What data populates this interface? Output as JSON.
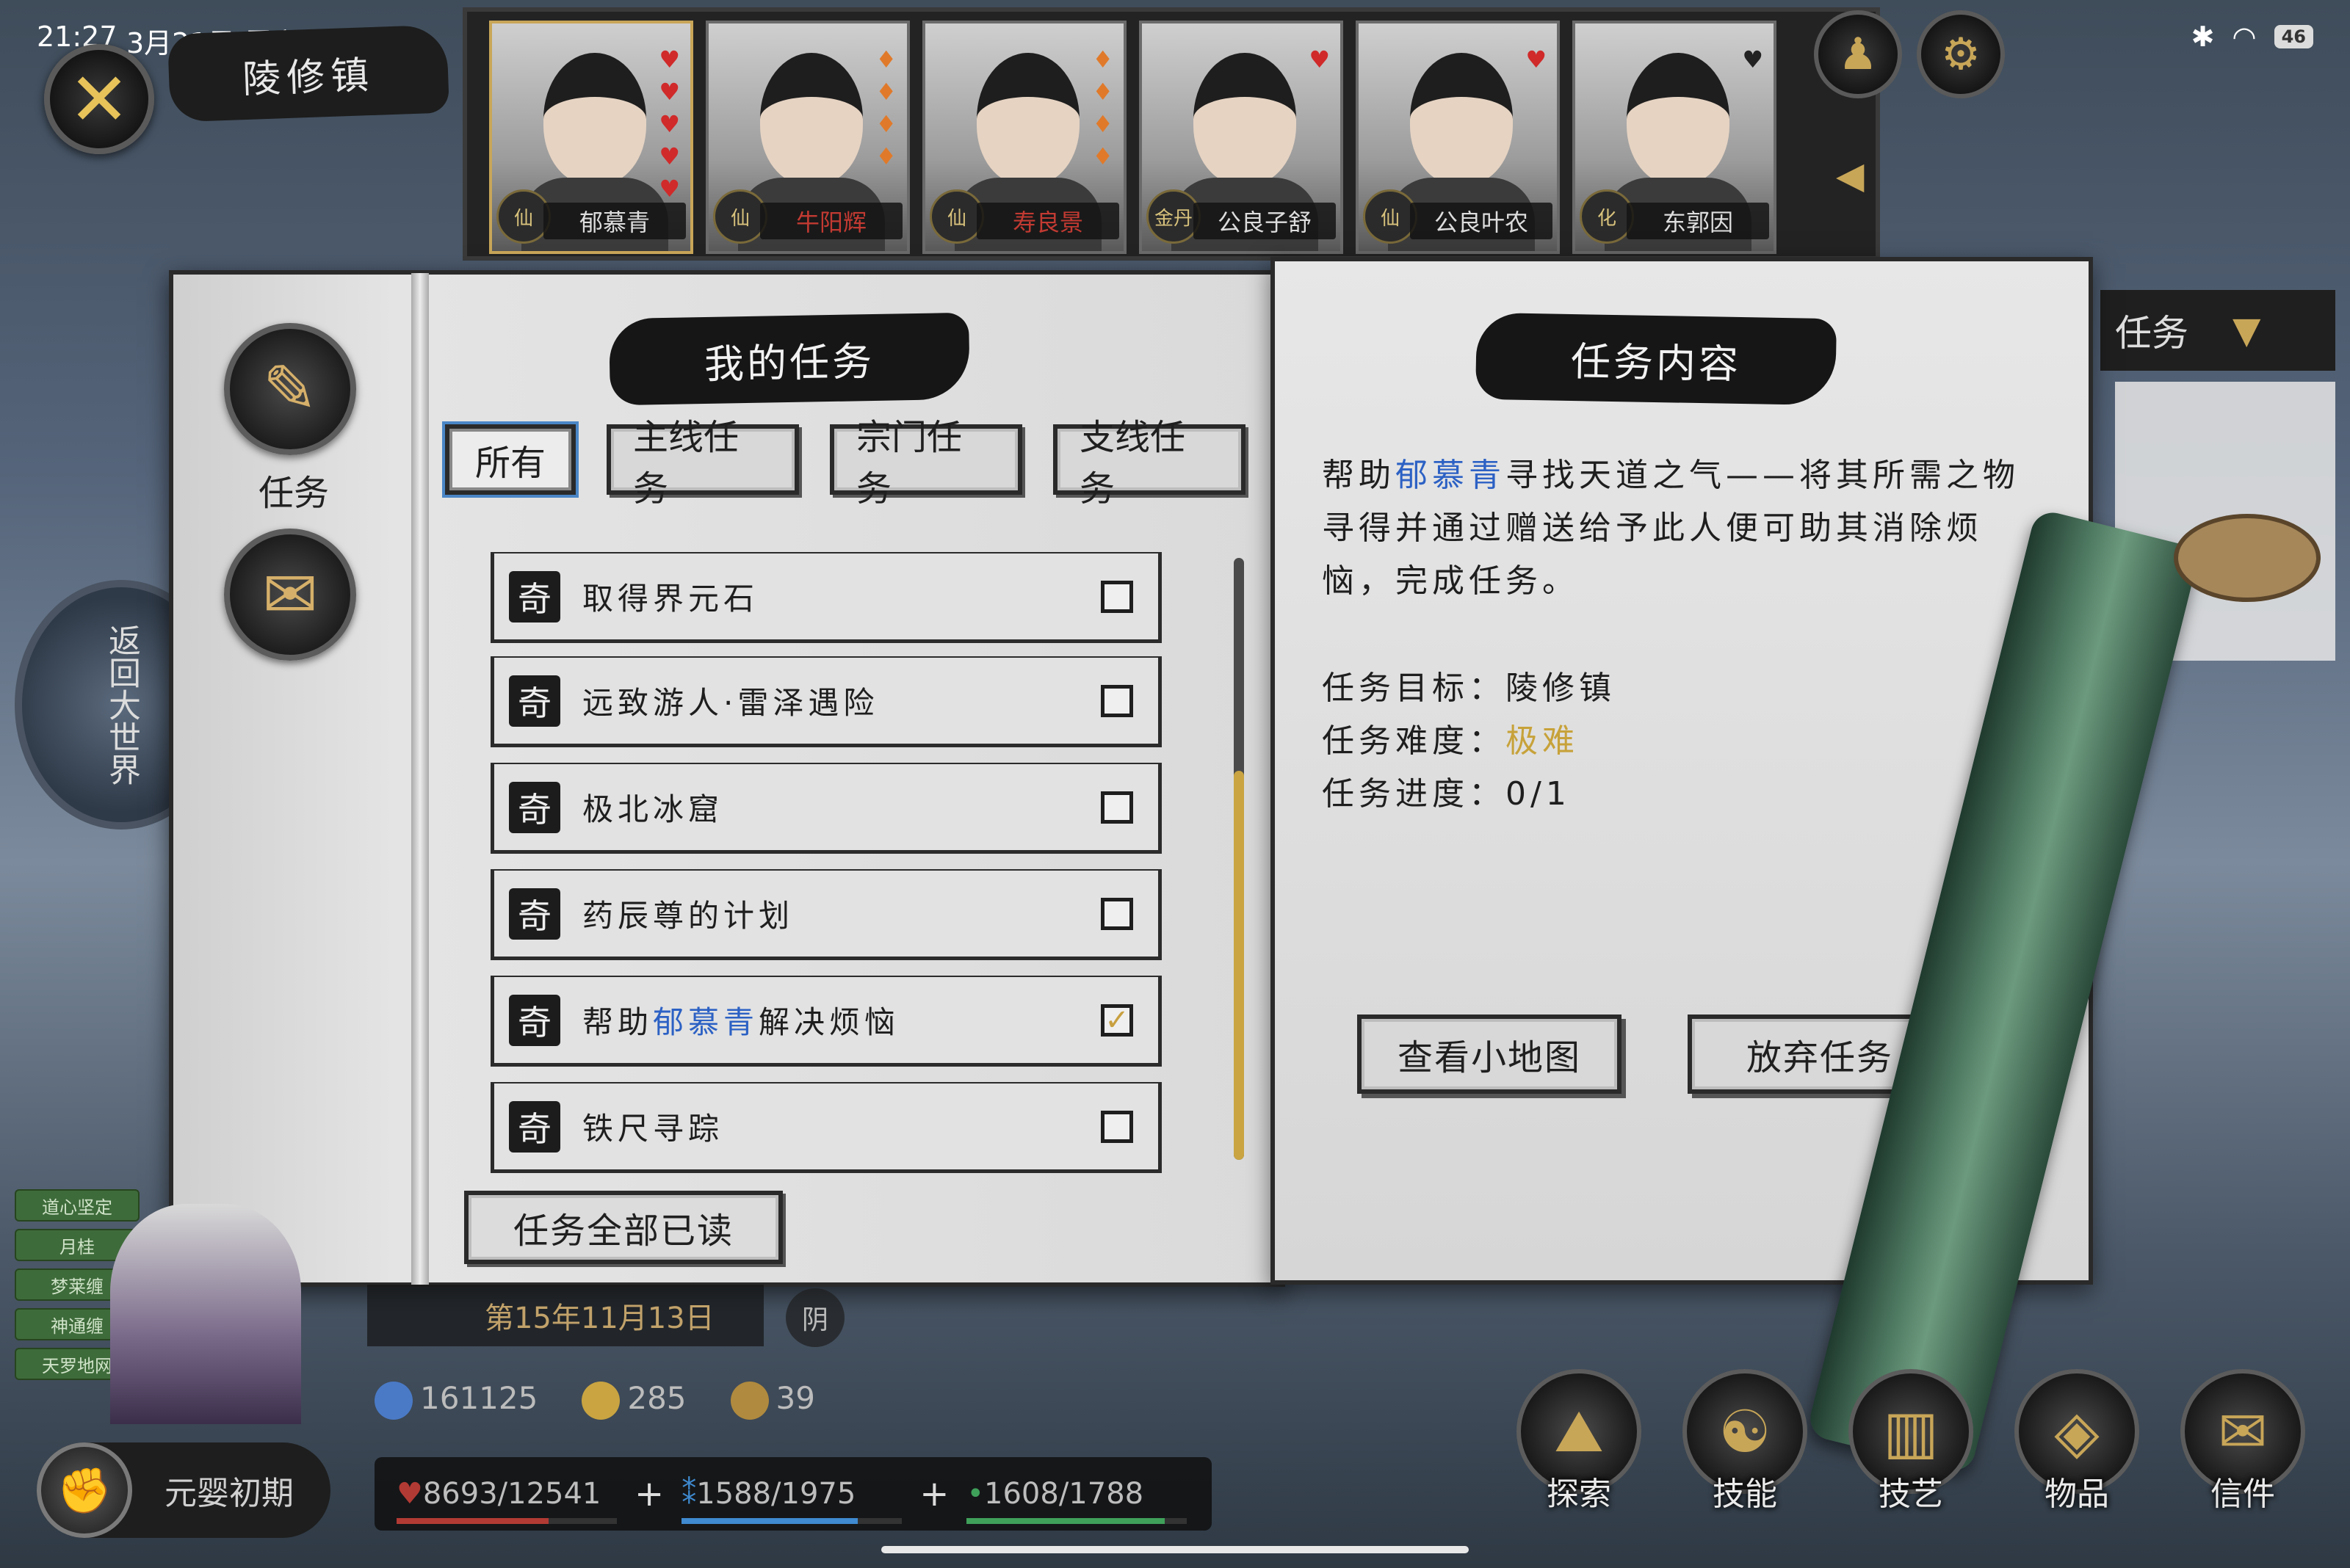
{
  "status_bar": {
    "time": "21:27",
    "date": "3月21日 周六",
    "battery": "46"
  },
  "location": "陵修镇",
  "characters": [
    {
      "name": "郁慕青",
      "seal": "仙"
    },
    {
      "name": "牛阳辉",
      "seal": "仙"
    },
    {
      "name": "寿良景",
      "seal": "仙"
    },
    {
      "name": "公良子舒",
      "seal": "金丹"
    },
    {
      "name": "公良叶农",
      "seal": "仙"
    },
    {
      "name": "东郭因",
      "seal": "化"
    }
  ],
  "right_tab": {
    "label": "任务"
  },
  "world_map": {
    "label": "返回大世界"
  },
  "book": {
    "side_icon_quest_label": "任务",
    "my_quests_title": "我的任务",
    "quest_content_title": "任务内容",
    "filter_tabs": [
      "所有",
      "主线任务",
      "宗门任务",
      "支线任务"
    ],
    "quests": [
      {
        "tag": "奇",
        "name": "取得界元石",
        "checked": false
      },
      {
        "tag": "奇",
        "name": "远致游人·雷泽遇险",
        "checked": false
      },
      {
        "tag": "奇",
        "name": "极北冰窟",
        "checked": false
      },
      {
        "tag": "奇",
        "name": "药辰尊的计划",
        "checked": false
      },
      {
        "tag": "奇",
        "name_pre": "帮助",
        "name_hl": "郁慕青",
        "name_post": "解决烦恼",
        "checked": true
      },
      {
        "tag": "奇",
        "name": "铁尺寻踪",
        "checked": false
      }
    ],
    "mark_all_read": "任务全部已读",
    "detail": {
      "desc_pre": "帮助",
      "desc_hl": "郁慕青",
      "desc_post": "寻找天道之气——将其所需之物寻得并通过赠送给予此人便可助其消除烦恼，完成任务。",
      "target_label": "任务目标：",
      "target_value": "陵修镇",
      "difficulty_label": "任务难度：",
      "difficulty_value": "极难",
      "progress_label": "任务进度：",
      "progress_value": "0/1"
    },
    "view_map_btn": "查看小地图",
    "abandon_btn": "放弃任务"
  },
  "hud": {
    "buffs": [
      "道心坚定",
      "月桂",
      "梦莱缠",
      "神通缠",
      "天罗地网"
    ],
    "date": "第15年11月13日",
    "date_badge": "阴",
    "spirit_stones": "161125",
    "coins": "285",
    "tokens": "39",
    "realm": "元婴初期",
    "hp": "8693/12541",
    "mp": "1588/1975",
    "stamina": "1608/1788",
    "menu": [
      "探索",
      "技能",
      "技艺",
      "物品",
      "信件"
    ]
  }
}
